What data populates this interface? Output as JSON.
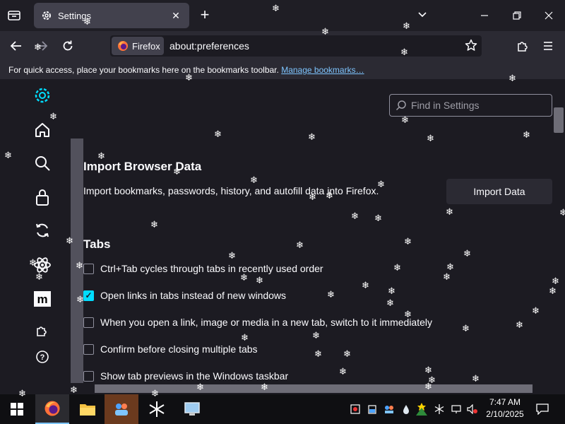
{
  "tab": {
    "title": "Settings",
    "close": "✕"
  },
  "new_tab": "+",
  "navbar": {
    "identity_label": "Firefox",
    "url": "about:preferences"
  },
  "bookmarks_bar": {
    "text": "For quick access, place your bookmarks here on the bookmarks toolbar.",
    "link": "Manage bookmarks…"
  },
  "search": {
    "placeholder": "Find in Settings"
  },
  "import": {
    "heading": "Import Browser Data",
    "description": "Import bookmarks, passwords, history, and autofill data into Firefox.",
    "button": "Import Data"
  },
  "tabs_section": {
    "heading": "Tabs",
    "options": [
      {
        "label": "Ctrl+Tab cycles through tabs in recently used order",
        "checked": false
      },
      {
        "label": "Open links in tabs instead of new windows",
        "checked": true
      },
      {
        "label": "When you open a link, image or media in a new tab, switch to it immediately",
        "checked": false
      },
      {
        "label": "Confirm before closing multiple tabs",
        "checked": false
      },
      {
        "label": "Show tab previews in the Windows taskbar",
        "checked": false
      }
    ]
  },
  "sidebar_icons": [
    "gear-icon",
    "home-icon",
    "search-icon",
    "lock-icon",
    "sync-icon",
    "atom-icon",
    "mozilla-icon",
    "extension-icon",
    "help-icon"
  ],
  "clock": {
    "time": "7:47 AM",
    "date": "2/10/2025"
  },
  "colors": {
    "accent": "#00ddff",
    "link": "#7ec5ff",
    "bg": "#1c1b22"
  }
}
